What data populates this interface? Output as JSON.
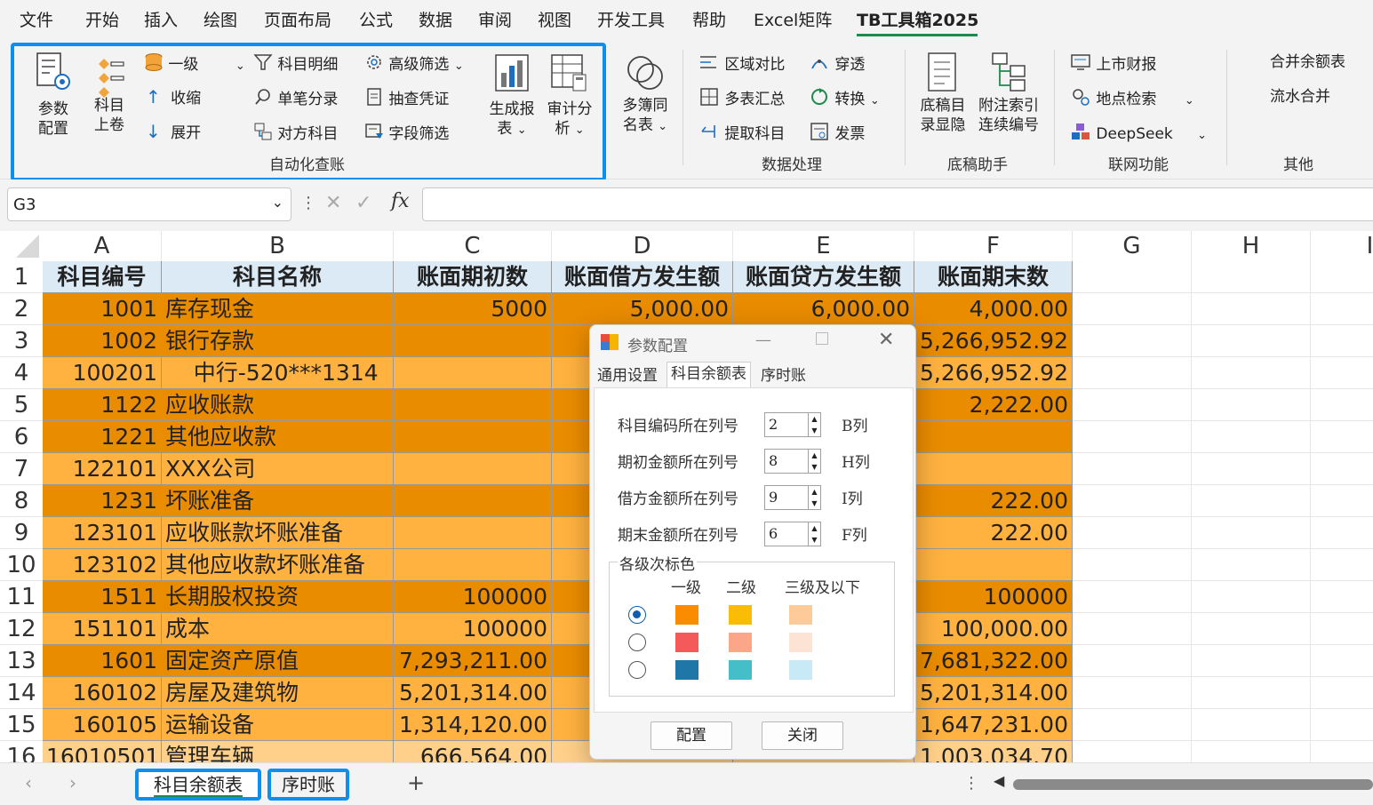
{
  "menu": {
    "tabs": [
      "文件",
      "开始",
      "插入",
      "绘图",
      "页面布局",
      "公式",
      "数据",
      "审阅",
      "视图",
      "开发工具",
      "帮助",
      "Excel矩阵",
      "TB工具箱2025"
    ],
    "active": "TB工具箱2025"
  },
  "ribbon": {
    "group1": {
      "caption": "自动化查账",
      "param_config": [
        "参数",
        "配置"
      ],
      "subject_up": [
        "科目",
        "上卷"
      ],
      "level1": "一级",
      "collapse": "收缩",
      "expand": "展开",
      "subject_detail": "科目明细",
      "single_entry": "单笔分录",
      "counter_subject": "对方科目",
      "advanced_filter": "高级筛选",
      "voucher_check": "抽查凭证",
      "field_filter": "字段筛选",
      "gen_report": [
        "生成报",
        "表"
      ],
      "audit_analysis": [
        "审计分",
        "析"
      ]
    },
    "group2": {
      "caption": "数据处理",
      "multi_book": [
        "多簿同",
        "名表"
      ],
      "region_compare": "区域对比",
      "penetrate": "穿透",
      "multi_summary": "多表汇总",
      "convert": "转换",
      "extract_subject": "提取科目",
      "invoice": "发票"
    },
    "group3": {
      "caption": "底稿助手",
      "draft_hide": [
        "底稿目",
        "录显隐"
      ],
      "note_index": [
        "附注索引",
        "连续编号"
      ]
    },
    "group4": {
      "caption": "联网功能",
      "listed_report": "上市财报",
      "location_search": "地点检索",
      "deepseek": "DeepSeek"
    },
    "group5": {
      "caption": "其他",
      "merge_balance": "合并余额表",
      "flow_merge": "流水合并"
    }
  },
  "formula_bar": {
    "name_box": "G3",
    "fx": "fx",
    "value": ""
  },
  "grid": {
    "columns": [
      "A",
      "B",
      "C",
      "D",
      "E",
      "F",
      "G",
      "H",
      "I"
    ],
    "header_row": [
      "科目编号",
      "科目名称",
      "账面期初数",
      "账面借方发生额",
      "账面贷方发生额",
      "账面期末数"
    ],
    "rows": [
      {
        "n": "1",
        "cells": [
          "科目编号",
          "科目名称",
          "账面期初数",
          "账面借方发生额",
          "账面贷方发生额",
          "账面期末数"
        ]
      },
      {
        "n": "2",
        "lvl": 1,
        "cells": [
          "1001",
          "库存现金",
          "5000",
          "5,000.00",
          "6,000.00",
          "4,000.00"
        ]
      },
      {
        "n": "3",
        "lvl": 1,
        "cells": [
          "1002",
          "银行存款",
          "",
          "",
          "",
          "5,266,952.92"
        ]
      },
      {
        "n": "4",
        "lvl": 2,
        "cells": [
          "100201",
          "    中行-520***1314",
          "",
          "",
          "",
          "5,266,952.92"
        ]
      },
      {
        "n": "5",
        "lvl": 1,
        "cells": [
          "1122",
          "应收账款",
          "",
          "",
          "",
          "2,222.00"
        ]
      },
      {
        "n": "6",
        "lvl": 1,
        "cells": [
          "1221",
          "其他应收款",
          "",
          "",
          "",
          ""
        ]
      },
      {
        "n": "7",
        "lvl": 2,
        "cells": [
          "122101",
          "XXX公司",
          "",
          "",
          "",
          ""
        ]
      },
      {
        "n": "8",
        "lvl": 1,
        "cells": [
          "1231",
          "坏账准备",
          "",
          "",
          "",
          "222.00"
        ]
      },
      {
        "n": "9",
        "lvl": 2,
        "cells": [
          "123101",
          "应收账款坏账准备",
          "",
          "",
          "",
          "222.00"
        ]
      },
      {
        "n": "10",
        "lvl": 2,
        "cells": [
          "123102",
          "其他应收款坏账准备",
          "",
          "",
          "",
          ""
        ]
      },
      {
        "n": "11",
        "lvl": 1,
        "cells": [
          "1511",
          "长期股权投资",
          "100000",
          "",
          "",
          "100000"
        ]
      },
      {
        "n": "12",
        "lvl": 2,
        "cells": [
          "151101",
          "成本",
          "100000",
          "",
          "",
          "100,000.00"
        ]
      },
      {
        "n": "13",
        "lvl": 1,
        "cells": [
          "1601",
          "固定资产原值",
          "7,293,211.00",
          "",
          "",
          "7,681,322.00"
        ]
      },
      {
        "n": "14",
        "lvl": 2,
        "cells": [
          "160102",
          "房屋及建筑物",
          "5,201,314.00",
          "",
          "",
          "5,201,314.00"
        ]
      },
      {
        "n": "15",
        "lvl": 2,
        "cells": [
          "160105",
          "运输设备",
          "1,314,120.00",
          "",
          "",
          "1,647,231.00"
        ]
      },
      {
        "n": "16",
        "lvl": 3,
        "cells": [
          "16010501",
          "管理车辆",
          "666,564.00",
          "",
          "",
          "1,003,034.70"
        ]
      }
    ]
  },
  "dialog": {
    "title": "参数配置",
    "tabs": [
      "通用设置",
      "科目余额表",
      "序时账"
    ],
    "active_tab": "科目余额表",
    "fields": [
      {
        "label": "科目编码所在列号",
        "value": "2",
        "col": "B列"
      },
      {
        "label": "期初金额所在列号",
        "value": "8",
        "col": "H列"
      },
      {
        "label": "借方金额所在列号",
        "value": "9",
        "col": "I列"
      },
      {
        "label": "期末金额所在列号",
        "value": "6",
        "col": "F列"
      }
    ],
    "color_group": {
      "title": "各级次标色",
      "headers": [
        "一级",
        "二级",
        "三级及以下"
      ],
      "schemes": [
        {
          "selected": true,
          "colors": [
            "#fb8c00",
            "#fbbc05",
            "#fccb99"
          ]
        },
        {
          "selected": false,
          "colors": [
            "#f45a5a",
            "#fba589",
            "#fde3d4"
          ]
        },
        {
          "selected": false,
          "colors": [
            "#1f77a7",
            "#44bfca",
            "#c8e9f6"
          ]
        }
      ]
    },
    "buttons": {
      "config": "配置",
      "close": "关闭"
    }
  },
  "sheets": {
    "tabs": [
      "科目余额表",
      "序时账"
    ],
    "active": "科目余额表",
    "add": "+"
  },
  "colors": {
    "level1": "#ea8c00",
    "level2": "#ffb23f",
    "level3": "#ffd089",
    "header": "#dceaf6",
    "highlight": "#0b8ff0"
  }
}
